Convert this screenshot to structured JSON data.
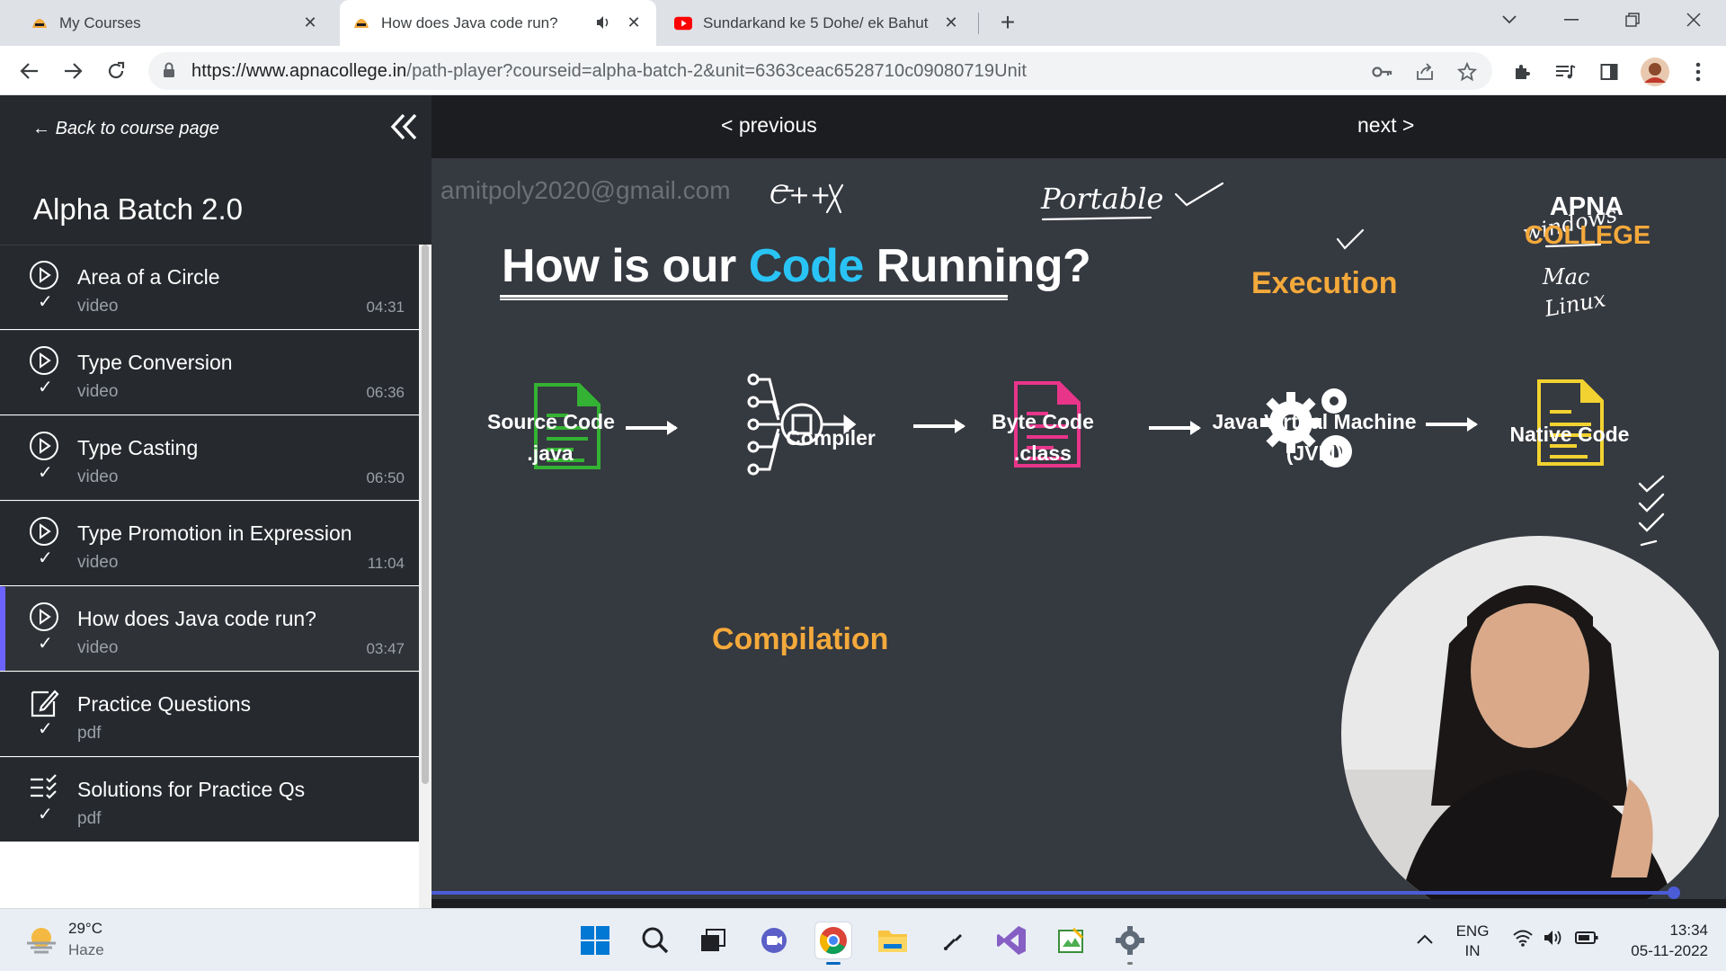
{
  "browser": {
    "tabs": [
      {
        "title": "My Courses"
      },
      {
        "title": "How does Java code run?"
      },
      {
        "title": "Sundarkand ke 5 Dohe/ ek Bahut"
      }
    ],
    "url_domain": "https://www.apnacollege.in",
    "url_path": "/path-player?courseid=alpha-batch-2&unit=6363ceac6528710c09080719Unit"
  },
  "sidebar": {
    "back_label": "Back to course page",
    "course_title": "Alpha Batch 2.0",
    "lessons": [
      {
        "name": "Area of a Circle",
        "type": "video",
        "duration": "04:31",
        "icon": "play-circle-icon"
      },
      {
        "name": "Type Conversion",
        "type": "video",
        "duration": "06:36",
        "icon": "play-circle-icon"
      },
      {
        "name": "Type Casting",
        "type": "video",
        "duration": "06:50",
        "icon": "play-circle-icon"
      },
      {
        "name": "Type Promotion in Expression",
        "type": "video",
        "duration": "11:04",
        "icon": "play-circle-icon"
      },
      {
        "name": "How does Java code run?",
        "type": "video",
        "duration": "03:47",
        "icon": "play-circle-icon"
      },
      {
        "name": "Practice Questions",
        "type": "pdf",
        "duration": "",
        "icon": "edit-note-icon"
      },
      {
        "name": "Solutions for Practice Qs",
        "type": "pdf",
        "duration": "",
        "icon": "checklist-icon"
      }
    ],
    "completed_check": "✓"
  },
  "player": {
    "prev_label": "< previous",
    "next_label": "next >",
    "watermark": "amitpoly2020@gmail.com",
    "slide": {
      "title_pre": "How is our ",
      "title_highlight": "Code",
      "title_post": " Running?",
      "execution_label": "Execution",
      "compilation_label": "Compilation",
      "logo_line1": "APNA",
      "logo_line2": "COLLEGE",
      "steps": [
        {
          "line1": "Source Code",
          "line2": ".java"
        },
        {
          "line1": "Compiler",
          "line2": ""
        },
        {
          "line1": "Byte Code",
          "line2": ".class"
        },
        {
          "line1": "Java Virtual Machine",
          "line2": "(JVM)"
        },
        {
          "line1": "Native Code",
          "line2": ""
        }
      ],
      "handwritten": {
        "cpp": "C++ ✗",
        "portable": "Portable ✓",
        "os_windows": "windows",
        "os_mac": "Mac",
        "os_linux": "Linux"
      }
    },
    "progress_fraction": 0.96
  },
  "taskbar": {
    "temperature": "29°C",
    "weather": "Haze",
    "language_line1": "ENG",
    "language_line2": "IN",
    "time": "13:34",
    "date": "05-11-2022"
  },
  "colors": {
    "accent_code": "#29c4f5",
    "orange": "#f4a93b",
    "green_file": "#34b233",
    "pink_file": "#e8358a",
    "yellow_file": "#f2d230",
    "active_lesson_bar": "#6c63ff"
  }
}
